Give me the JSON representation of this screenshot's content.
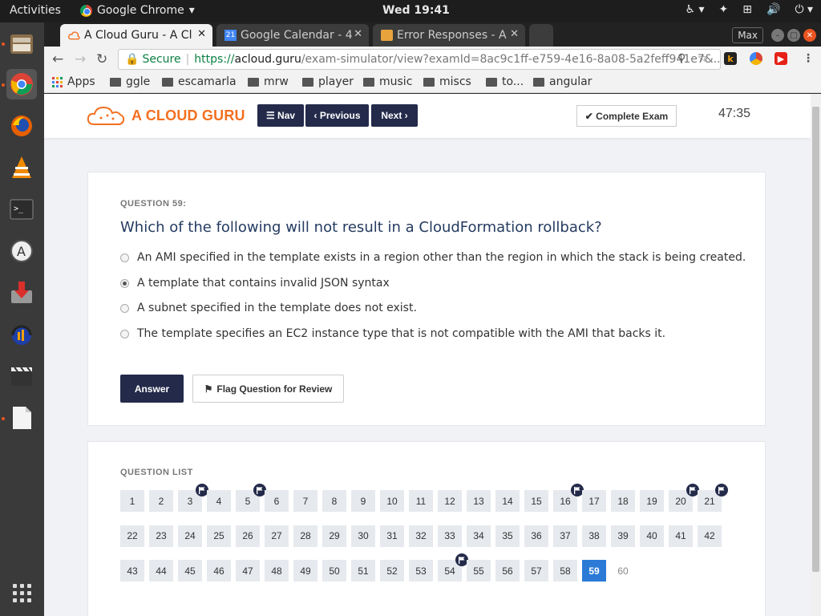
{
  "system": {
    "activities_label": "Activities",
    "app_menu_label": "Google Chrome",
    "clock": "Wed 19:41"
  },
  "dock": {
    "items": [
      "files-icon",
      "chrome-icon",
      "firefox-icon",
      "vlc-icon",
      "terminal-icon",
      "update-icon",
      "downloader-icon",
      "audacity-icon",
      "video-editor-icon",
      "document-icon"
    ]
  },
  "browser": {
    "tabs": [
      {
        "title": "A Cloud Guru - A Cl",
        "active": true
      },
      {
        "title": "Google Calendar - 4",
        "active": false,
        "badge": "21"
      },
      {
        "title": "Error Responses - A",
        "active": false
      }
    ],
    "max_label": "Max",
    "omnibox": {
      "secure_label": "Secure",
      "protocol": "https://",
      "host": "acloud.guru",
      "path": "/exam-simulator/view?examId=8ac9c1ff-e759-4e16-8a08-5a2feff941e7&..."
    },
    "bookmarks": [
      {
        "label": "Apps",
        "type": "apps"
      },
      {
        "label": "ggle",
        "type": "folder"
      },
      {
        "label": "escamarla",
        "type": "folder"
      },
      {
        "label": "mrw",
        "type": "folder"
      },
      {
        "label": "player",
        "type": "folder"
      },
      {
        "label": "music",
        "type": "folder"
      },
      {
        "label": "miscs",
        "type": "folder"
      },
      {
        "label": "to...",
        "type": "folder"
      },
      {
        "label": "angular",
        "type": "folder"
      }
    ]
  },
  "header": {
    "logo_text": "A CLOUD GURU",
    "nav_label": "Nav",
    "previous_label": "Previous",
    "next_label": "Next",
    "complete_label": "Complete Exam",
    "timer": "47:35"
  },
  "question": {
    "number_label": "QUESTION 59:",
    "text": "Which of the following will not result in a CloudFormation rollback?",
    "options": [
      {
        "text": "An AMI specified in the template exists in a region other than the region in which the stack is being created.",
        "selected": false
      },
      {
        "text": "A template that contains invalid JSON syntax",
        "selected": true
      },
      {
        "text": "A subnet specified in the template does not exist.",
        "selected": false
      },
      {
        "text": "The template specifies an EC2 instance type that is not compatible with the AMI that backs it.",
        "selected": false
      }
    ],
    "answer_label": "Answer",
    "flag_label": "Flag Question for Review"
  },
  "question_list": {
    "title": "QUESTION LIST",
    "current": 59,
    "total_shown": 60,
    "flagged": [
      3,
      5,
      16,
      20,
      21,
      54
    ],
    "unvisited": [
      60
    ]
  },
  "colors": {
    "brand_orange": "#f37021",
    "navy": "#242a4a",
    "current_blue": "#2b7bd6"
  }
}
